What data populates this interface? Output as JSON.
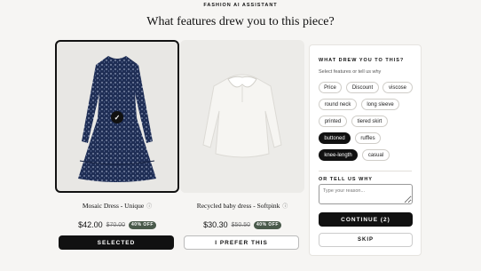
{
  "header": {
    "eyebrow": "FASHION AI ASSISTANT",
    "title": "What features drew you to this piece?"
  },
  "products": [
    {
      "name": "Mosaic Dress - Unique",
      "info_icon": "info-icon",
      "price": "$42.00",
      "original_price": "$70.00",
      "badge": "40% OFF",
      "button": "SELECTED",
      "selected": true
    },
    {
      "name": "Recycled baby dress - Softpink",
      "info_icon": "info-icon",
      "price": "$30.30",
      "original_price": "$50.50",
      "badge": "40% OFF",
      "button": "I PREFER THIS",
      "selected": false
    }
  ],
  "panel": {
    "title": "WHAT DREW YOU TO THIS?",
    "subtitle": "Select features or tell us why",
    "chips": [
      {
        "label": "Price",
        "selected": false
      },
      {
        "label": "Discount",
        "selected": false
      },
      {
        "label": "viscose",
        "selected": false
      },
      {
        "label": "round neck",
        "selected": false
      },
      {
        "label": "long sleeve",
        "selected": false
      },
      {
        "label": "printed",
        "selected": false
      },
      {
        "label": "tiered skirt",
        "selected": false
      },
      {
        "label": "buttoned",
        "selected": true
      },
      {
        "label": "ruffles",
        "selected": false
      },
      {
        "label": "knee-length",
        "selected": true
      },
      {
        "label": "casual",
        "selected": false
      }
    ],
    "or_label": "OR TELL US WHY",
    "reason_placeholder": "Type your reason...",
    "continue_label": "CONTINUE (2)",
    "skip_label": "SKIP"
  },
  "colors": {
    "background": "#f6f5f3",
    "primary": "#111111",
    "badge": "#4a5a4b",
    "dress_navy": "#1f2e55",
    "dress_white": "#f3f2ef"
  }
}
